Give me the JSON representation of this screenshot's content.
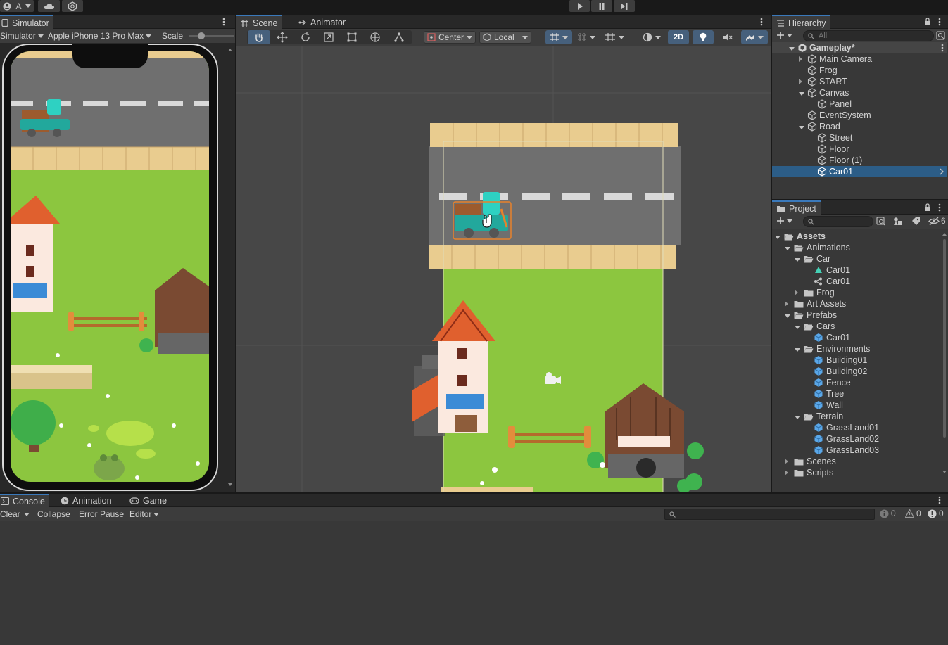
{
  "topbar": {
    "account_initial": "A",
    "play_icon": "play-icon",
    "pause_icon": "pause-icon",
    "step_icon": "step-icon"
  },
  "simulator": {
    "tab_label": "Simulator",
    "mode_label": "Simulator",
    "device_label": "Apple iPhone 13 Pro Max",
    "scale_label": "Scale"
  },
  "scene": {
    "tabs": [
      {
        "label": "Scene"
      },
      {
        "label": "Animator"
      }
    ],
    "pivot_label": "Center",
    "space_label": "Local",
    "mode2d_label": "2D"
  },
  "hierarchy": {
    "tab_label": "Hierarchy",
    "search_placeholder": "All",
    "items": [
      {
        "label": "Gameplay*",
        "depth": 0,
        "expanded": true,
        "root": true
      },
      {
        "label": "Main Camera",
        "depth": 1,
        "expander": "collapsed"
      },
      {
        "label": "Frog",
        "depth": 1,
        "expander": "none"
      },
      {
        "label": "START",
        "depth": 1,
        "expander": "collapsed"
      },
      {
        "label": "Canvas",
        "depth": 1,
        "expander": "expanded"
      },
      {
        "label": "Panel",
        "depth": 2,
        "expander": "none"
      },
      {
        "label": "EventSystem",
        "depth": 1,
        "expander": "none"
      },
      {
        "label": "Road",
        "depth": 1,
        "expander": "expanded"
      },
      {
        "label": "Street",
        "depth": 2,
        "expander": "none"
      },
      {
        "label": "Floor",
        "depth": 2,
        "expander": "none"
      },
      {
        "label": "Floor (1)",
        "depth": 2,
        "expander": "none"
      },
      {
        "label": "Car01",
        "depth": 2,
        "expander": "none",
        "selected": true
      }
    ]
  },
  "project": {
    "tab_label": "Project",
    "hidden_count": "6",
    "items": [
      {
        "label": "Assets",
        "depth": 0,
        "type": "folder-open",
        "expander": "expanded",
        "bold": true
      },
      {
        "label": "Animations",
        "depth": 1,
        "type": "folder-open",
        "expander": "expanded"
      },
      {
        "label": "Car",
        "depth": 2,
        "type": "folder-open",
        "expander": "expanded"
      },
      {
        "label": "Car01",
        "depth": 3,
        "type": "animator-controller",
        "expander": "none"
      },
      {
        "label": "Car01",
        "depth": 3,
        "type": "animation-clip",
        "expander": "none"
      },
      {
        "label": "Frog",
        "depth": 2,
        "type": "folder",
        "expander": "collapsed"
      },
      {
        "label": "Art Assets",
        "depth": 1,
        "type": "folder",
        "expander": "collapsed"
      },
      {
        "label": "Prefabs",
        "depth": 1,
        "type": "folder-open",
        "expander": "expanded"
      },
      {
        "label": "Cars",
        "depth": 2,
        "type": "folder-open",
        "expander": "expanded"
      },
      {
        "label": "Car01",
        "depth": 3,
        "type": "prefab",
        "expander": "none"
      },
      {
        "label": "Environments",
        "depth": 2,
        "type": "folder-open",
        "expander": "expanded"
      },
      {
        "label": "Building01",
        "depth": 3,
        "type": "prefab",
        "expander": "none"
      },
      {
        "label": "Building02",
        "depth": 3,
        "type": "prefab",
        "expander": "none"
      },
      {
        "label": "Fence",
        "depth": 3,
        "type": "prefab",
        "expander": "none"
      },
      {
        "label": "Tree",
        "depth": 3,
        "type": "prefab",
        "expander": "none"
      },
      {
        "label": "Wall",
        "depth": 3,
        "type": "prefab",
        "expander": "none"
      },
      {
        "label": "Terrain",
        "depth": 2,
        "type": "folder-open",
        "expander": "expanded"
      },
      {
        "label": "GrassLand01",
        "depth": 3,
        "type": "prefab",
        "expander": "none"
      },
      {
        "label": "GrassLand02",
        "depth": 3,
        "type": "prefab",
        "expander": "none"
      },
      {
        "label": "GrassLand03",
        "depth": 3,
        "type": "prefab",
        "expander": "none"
      },
      {
        "label": "Scenes",
        "depth": 1,
        "type": "folder",
        "expander": "collapsed"
      },
      {
        "label": "Scripts",
        "depth": 1,
        "type": "folder",
        "expander": "collapsed"
      }
    ]
  },
  "console": {
    "tabs": [
      {
        "label": "Console"
      },
      {
        "label": "Animation"
      },
      {
        "label": "Game"
      }
    ],
    "clear_label": "Clear",
    "collapse_label": "Collapse",
    "error_pause_label": "Error Pause",
    "editor_label": "Editor",
    "log_count": "0",
    "warning_count": "0",
    "error_count": "0"
  },
  "colors": {
    "accent": "#3a79bb",
    "selection": "#2c5d87",
    "grass": "#8cc63f",
    "road": "#6f6f6f",
    "prefab_blue": "#5aa7e8"
  }
}
